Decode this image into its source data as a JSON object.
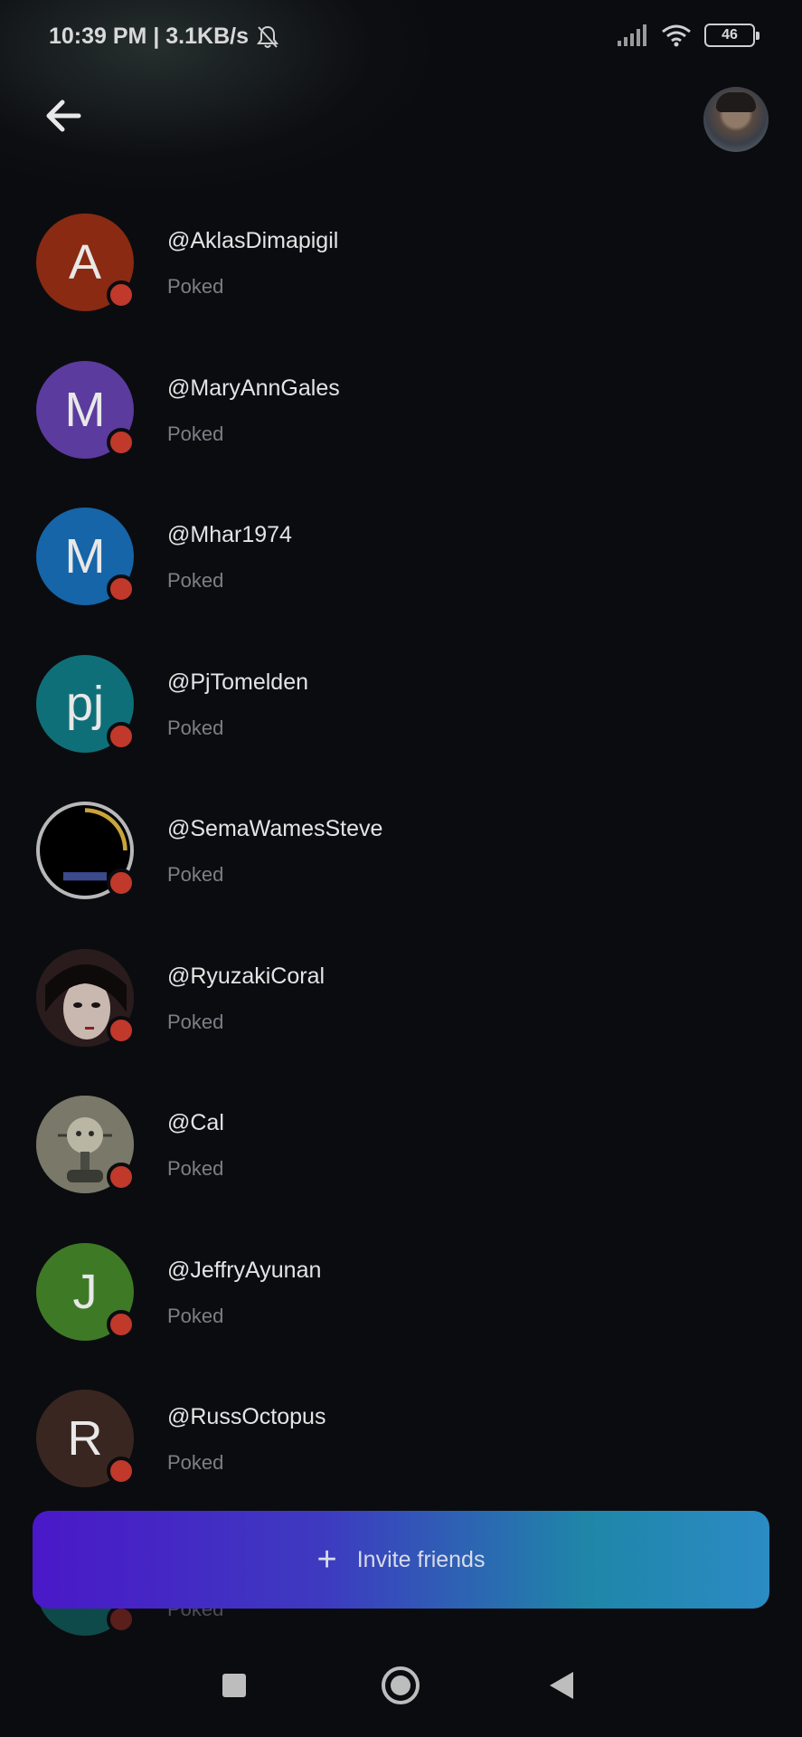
{
  "status_bar": {
    "time": "10:39 PM | 3.1KB/s",
    "battery": "46",
    "icons": [
      "bell-off-icon",
      "signal-icon",
      "wifi-icon",
      "battery-icon"
    ]
  },
  "header": {
    "back_icon": "arrow-left-icon",
    "profile_avatar": "user-photo"
  },
  "friends": [
    {
      "initial": "A",
      "username": "@AklasDimapigil",
      "status": "Poked",
      "color": "#8a2a12"
    },
    {
      "initial": "M",
      "username": "@MaryAnnGales",
      "status": "Poked",
      "color": "#5b3b9e"
    },
    {
      "initial": "M",
      "username": "@Mhar1974",
      "status": "Poked",
      "color": "#1565a8"
    },
    {
      "initial": "pj",
      "username": "@PjTomelden",
      "status": "Poked",
      "color": "#0f6f78"
    },
    {
      "initial": "",
      "username": "@SemaWamesSteve",
      "status": "Poked",
      "color": "#000000"
    },
    {
      "initial": "",
      "username": "@RyuzakiCoral",
      "status": "Poked",
      "color": "#2a1c1c"
    },
    {
      "initial": "",
      "username": "@Cal",
      "status": "Poked",
      "color": "#6b6a5c"
    },
    {
      "initial": "J",
      "username": "@JeffryAyunan",
      "status": "Poked",
      "color": "#3e7a26"
    },
    {
      "initial": "R",
      "username": "@RussOctopus",
      "status": "Poked",
      "color": "#3a2620"
    }
  ],
  "partial_row_status": "Poked",
  "invite": {
    "label": "Invite friends",
    "plus": "+"
  },
  "colors": {
    "background": "#0b0c10",
    "status_dot": "#c0392b",
    "invite_gradient_start": "#4a18c8",
    "invite_gradient_end": "#2b8bc4"
  }
}
